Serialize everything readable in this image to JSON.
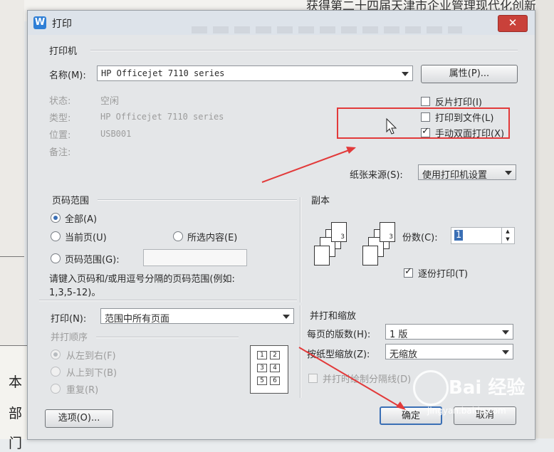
{
  "background": {
    "doc_top_text": "获得第二十四届天津市企业管理现代化创新成果二等奖。主要参与",
    "doc_left_text": [
      "本",
      "部",
      "门"
    ]
  },
  "dialog": {
    "title": "打印",
    "app_icon": "W",
    "close_icon": "close-icon",
    "printer": {
      "section": "打印机",
      "name_label": "名称(M):",
      "name_value": "HP Officejet 7110 series",
      "properties_button": "属性(P)...",
      "status_label": "状态:",
      "status_value": "空闲",
      "type_label": "类型:",
      "type_value": "HP Officejet 7110 series",
      "location_label": "位置:",
      "location_value": "USB001",
      "comment_label": "备注:",
      "reverse_print": "反片打印(I)",
      "print_to_file": "打印到文件(L)",
      "manual_duplex": "手动双面打印(X)",
      "reverse_checked": false,
      "file_checked": false,
      "duplex_checked": true,
      "paper_source_label": "纸张来源(S):",
      "paper_source_value": "使用打印机设置"
    },
    "page_range": {
      "section": "页码范围",
      "all": "全部(A)",
      "current": "当前页(U)",
      "selection": "所选内容(E)",
      "pages": "页码范围(G):",
      "hint_line1": "请键入页码和/或用逗号分隔的页码范围(例如:",
      "hint_line2": "1,3,5-12)。"
    },
    "copies": {
      "section": "副本",
      "count_label": "份数(C):",
      "count_value": "1",
      "collate": "逐份打印(T)",
      "collate_checked": true
    },
    "print_what": {
      "label": "打印(N):",
      "value": "范围中所有页面",
      "order_label": "并打顺序",
      "left_to_right": "从左到右(F)",
      "top_to_bottom": "从上到下(B)",
      "repeat": "重复(R)"
    },
    "zoom": {
      "section": "并打和缩放",
      "pages_per_sheet_label": "每页的版数(H):",
      "pages_per_sheet_value": "1 版",
      "scale_label": "按纸型缩放(Z):",
      "scale_value": "无缩放",
      "draw_borders": "并打时绘制分隔线(D)"
    },
    "options_button": "选项(O)...",
    "ok_button": "确定",
    "cancel_button": "取消"
  },
  "watermark": {
    "brand": "Bai 经验",
    "url": "jingyan.baidu.com"
  },
  "colors": {
    "annotation": "#e23a3a",
    "accent": "#3a6fb5"
  }
}
